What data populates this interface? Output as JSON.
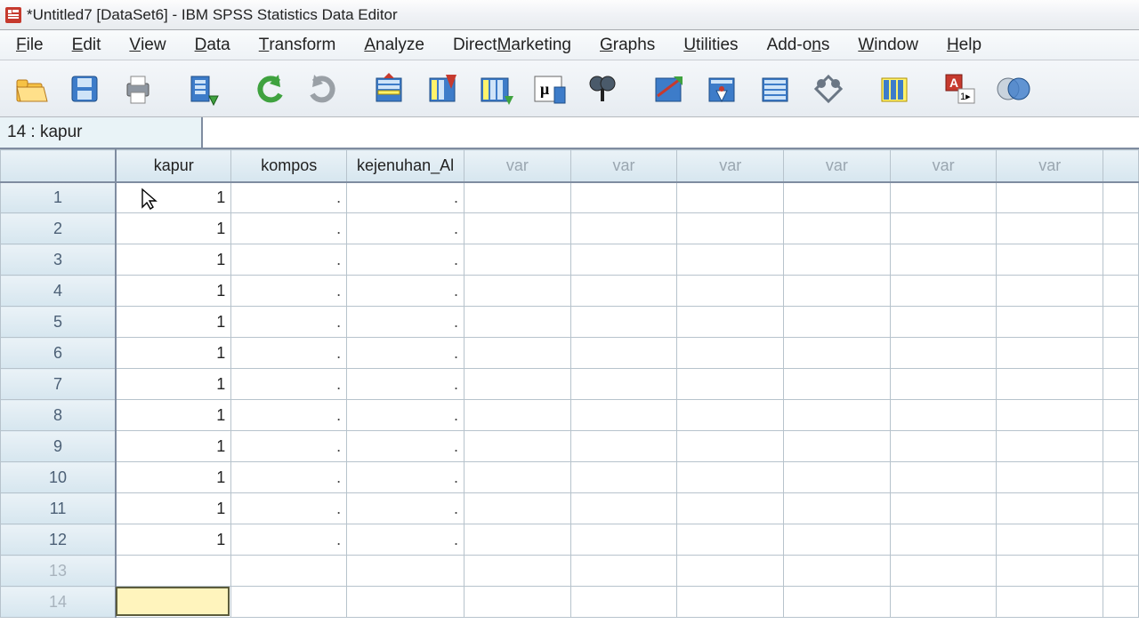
{
  "title": "*Untitled7 [DataSet6] - IBM SPSS Statistics Data Editor",
  "menus": [
    "File",
    "Edit",
    "View",
    "Data",
    "Transform",
    "Analyze",
    "Direct Marketing",
    "Graphs",
    "Utilities",
    "Add-ons",
    "Window",
    "Help"
  ],
  "menu_underline_index": [
    0,
    0,
    0,
    0,
    0,
    0,
    7,
    0,
    0,
    5,
    0,
    0
  ],
  "toolbar_icons": [
    "open",
    "save",
    "print",
    "",
    "recent-dialogs",
    "",
    "undo",
    "redo",
    "",
    "goto-case",
    "goto-variable",
    "variables",
    "run-descriptives",
    "find",
    "",
    "split-file",
    "weight-cases",
    "select-cases",
    "value-labels",
    "",
    "use-sets",
    "",
    "spellcheck",
    "customize"
  ],
  "cell_reference": "14 : kapur",
  "formula_value": "",
  "columns": {
    "defined": [
      "kapur",
      "kompos",
      "kejenuhan_Al"
    ],
    "placeholder": "var",
    "placeholder_count": 6
  },
  "row_count_filled": 12,
  "row_count_visible": 14,
  "data": {
    "kapur": [
      "1",
      "1",
      "1",
      "1",
      "1",
      "1",
      "1",
      "1",
      "1",
      "1",
      "1",
      "1"
    ],
    "kompos": [
      ".",
      ".",
      ".",
      ".",
      ".",
      ".",
      ".",
      ".",
      ".",
      ".",
      ".",
      "."
    ],
    "kejenuhan_Al": [
      ".",
      ".",
      ".",
      ".",
      ".",
      ".",
      ".",
      ".",
      ".",
      ".",
      ".",
      "."
    ]
  },
  "active_cell": {
    "row": 14,
    "column": "kapur"
  },
  "colors": {
    "header_bg": "#d6e6ef",
    "grid_line": "#b7c3cc",
    "accent_border": "#7f8ca0",
    "highlight": "#fff4bd"
  }
}
